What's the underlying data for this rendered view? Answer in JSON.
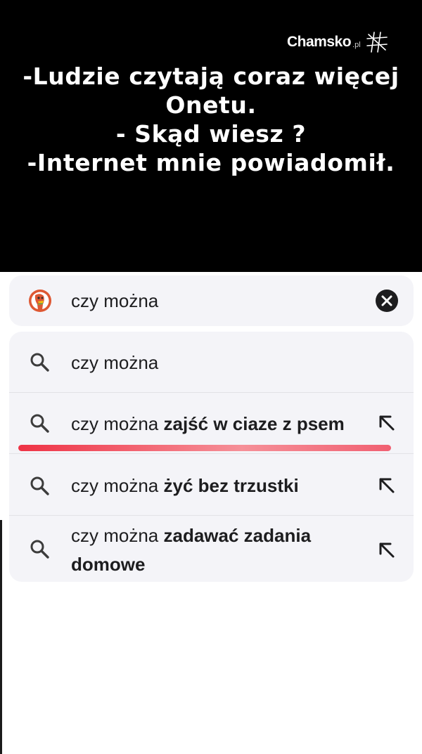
{
  "meme": {
    "logo": {
      "name": "Chamsko",
      "tld": ".pl"
    },
    "caption_lines": [
      "-Ludzie czytają coraz więcej",
      "Onetu.",
      "- Skąd wiesz ?",
      "-Internet  mnie powiadomił."
    ]
  },
  "search": {
    "query": "czy można",
    "engine_icon": "duckduckgo-icon",
    "clear_icon": "close-circle-icon"
  },
  "suggestions": [
    {
      "prefix": "czy można",
      "bold": "",
      "icon": "search-icon",
      "fill_icon": ""
    },
    {
      "prefix": "czy można ",
      "bold": "zajść w ciaze z psem",
      "icon": "search-icon",
      "fill_icon": "arrow-up-left-icon"
    },
    {
      "prefix": "czy można ",
      "bold": "żyć bez trzustki",
      "icon": "search-icon",
      "fill_icon": "arrow-up-left-icon"
    },
    {
      "prefix": "czy można ",
      "bold": "zadawać zadania",
      "bold_line2": "domowe",
      "icon": "search-icon",
      "fill_icon": "arrow-up-left-icon"
    }
  ],
  "colors": {
    "top_background": "#000000",
    "card_background": "#f4f4f8",
    "highlight": "#ee283c",
    "ddg_orange": "#de5833"
  }
}
